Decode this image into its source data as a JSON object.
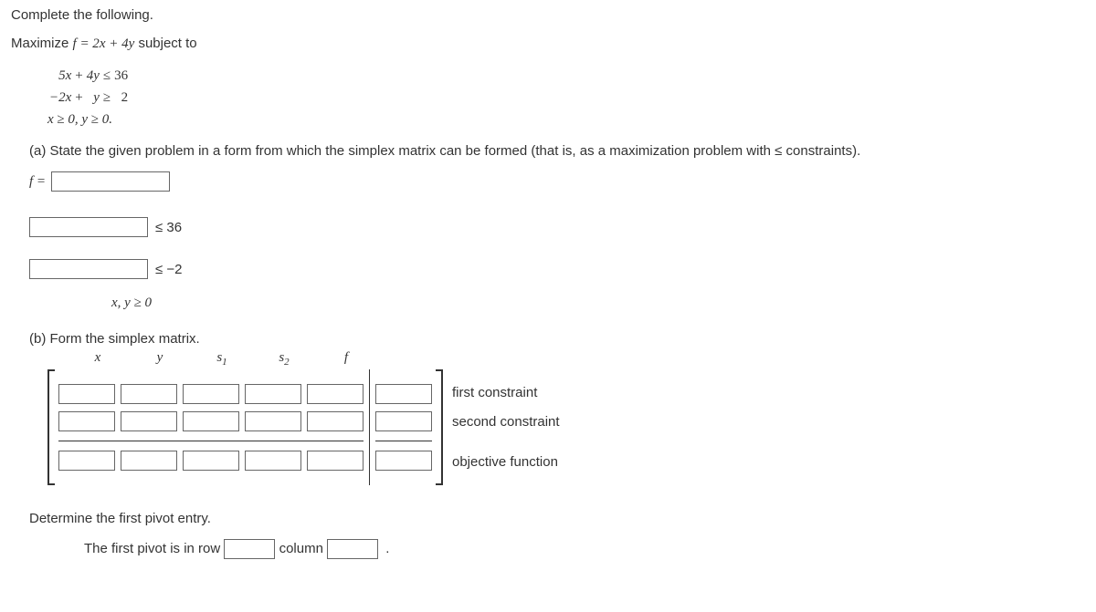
{
  "intro": "Complete the following.",
  "objective_line_pre": "Maximize ",
  "objective_eq": "f = 2x + 4y",
  "objective_line_post": " subject to",
  "problem": {
    "r1c1": "5x",
    "r1op1": "+",
    "r1c2": "4y",
    "r1op2": "≤",
    "r1rhs": "36",
    "r2c1": "−2x",
    "r2op1": "+",
    "r2c2": "y",
    "r2op2": "≥",
    "r2rhs": "2",
    "r3": "x ≥ 0,  y ≥ 0."
  },
  "part_a": "(a) State the given problem in a form from which the simplex matrix can be formed (that is, as a maximization problem with ≤ constraints).",
  "f_eq_label": "f =",
  "c1_label": "≤ 36",
  "c2_label": "≤ −2",
  "nonneg_label": "x, y ≥ 0",
  "part_b": "(b) Form the simplex matrix.",
  "headers": {
    "x": "x",
    "y": "y",
    "s1": "s",
    "s1sub": "1",
    "s2": "s",
    "s2sub": "2",
    "f": "f"
  },
  "row_labels": {
    "r1": "first constraint",
    "r2": "second constraint",
    "r3": "objective function"
  },
  "pivot_intro": "Determine the first pivot entry.",
  "pivot_pre": "The first pivot is in row",
  "pivot_mid": "column",
  "pivot_post": "."
}
